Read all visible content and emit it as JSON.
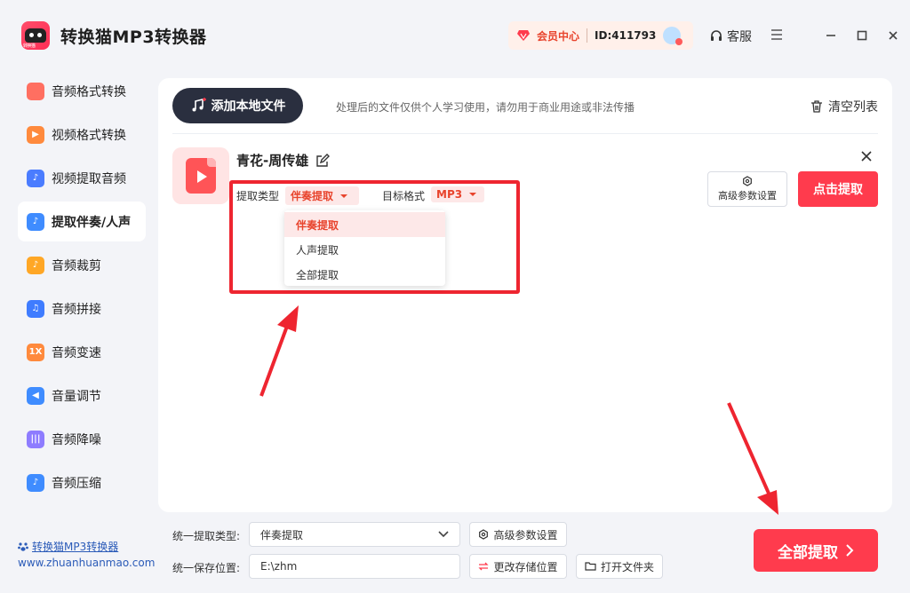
{
  "app": {
    "title": "转换猫MP3转换器",
    "logo_text": "转换猫"
  },
  "vip": {
    "label": "会员中心",
    "user_id": "ID:411793"
  },
  "header": {
    "customer_service": "客服"
  },
  "sidebar": {
    "items": [
      {
        "label": "音频格式转换",
        "icon": "audio-convert-icon",
        "color": "#ff6f61"
      },
      {
        "label": "视频格式转换",
        "icon": "video-convert-icon",
        "color": "#ff8a3d"
      },
      {
        "label": "视频提取音频",
        "icon": "video-extract-icon",
        "color": "#4a7cff"
      },
      {
        "label": "提取伴奏/人声",
        "icon": "vocal-extract-icon",
        "color": "#3f8cff",
        "active": true
      },
      {
        "label": "音频裁剪",
        "icon": "audio-cut-icon",
        "color": "#ffa726"
      },
      {
        "label": "音频拼接",
        "icon": "audio-merge-icon",
        "color": "#3f7cff"
      },
      {
        "label": "音频变速",
        "icon": "audio-speed-icon",
        "color": "#ff8a3d",
        "icon_text": "1X"
      },
      {
        "label": "音量调节",
        "icon": "volume-icon",
        "color": "#3f8cff"
      },
      {
        "label": "音频降噪",
        "icon": "denoise-icon",
        "color": "#8e7cff"
      },
      {
        "label": "音频压缩",
        "icon": "audio-compress-icon",
        "color": "#3f8cff"
      }
    ],
    "footer_link": "转换猫MP3转换器",
    "footer_url": "www.zhuanhuanmao.com"
  },
  "toolbar": {
    "add_file": "添加本地文件",
    "notice": "处理后的文件仅供个人学习使用，请勿用于商业用途或非法传播",
    "clear_list": "清空列表"
  },
  "file": {
    "name": "青花-周传雄",
    "extract_type_label": "提取类型",
    "extract_type_value": "伴奏提取",
    "target_format_label": "目标格式",
    "target_format_value": "MP3",
    "advanced_settings": "高级参数设置",
    "extract_button": "点击提取"
  },
  "dropdown": {
    "options": [
      "伴奏提取",
      "人声提取",
      "全部提取"
    ],
    "selected": 0
  },
  "bottom": {
    "unified_type_label": "统一提取类型:",
    "unified_type_value": "伴奏提取",
    "advanced_settings": "高级参数设置",
    "save_location_label": "统一保存位置:",
    "save_location_value": "E:\\zhm",
    "change_location": "更改存储位置",
    "open_folder": "打开文件夹",
    "extract_all": "全部提取"
  },
  "colors": {
    "accent": "#ff3b4d",
    "highlight": "#ee2530",
    "dark_button": "#2a2f3f"
  }
}
